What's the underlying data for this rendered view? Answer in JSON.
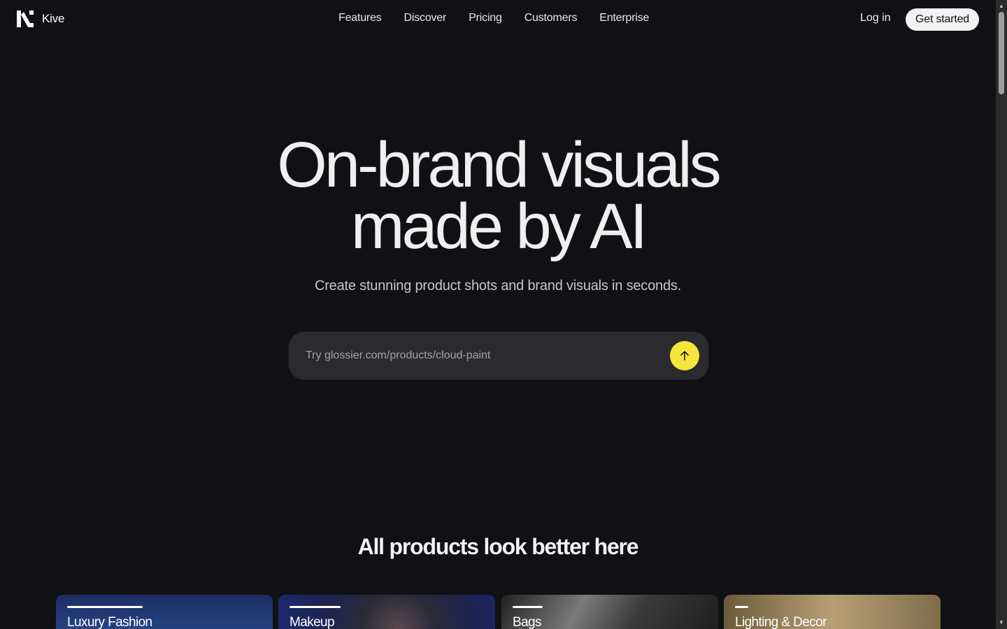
{
  "brand": {
    "name": "Kive",
    "logo_icon": "kive-logo-icon"
  },
  "nav": {
    "items": [
      {
        "label": "Features"
      },
      {
        "label": "Discover"
      },
      {
        "label": "Pricing"
      },
      {
        "label": "Customers"
      },
      {
        "label": "Enterprise"
      }
    ],
    "login_label": "Log in",
    "cta_label": "Get started"
  },
  "hero": {
    "title_line1": "On-brand visuals",
    "title_line2": "made by AI",
    "subtitle": "Create stunning product shots and brand visuals in seconds.",
    "search_placeholder": "Try glossier.com/products/cloud-paint",
    "submit_icon": "arrow-up-icon",
    "accent_color": "#f6e53c"
  },
  "products": {
    "title": "All products look better here",
    "cards": [
      {
        "label": "Luxury Fashion"
      },
      {
        "label": "Makeup"
      },
      {
        "label": "Bags"
      },
      {
        "label": "Lighting & Decor"
      }
    ]
  },
  "colors": {
    "background": "#111115",
    "text": "#efefef",
    "muted_text": "#c7c7cb",
    "search_bg": "#2b2b2e"
  }
}
